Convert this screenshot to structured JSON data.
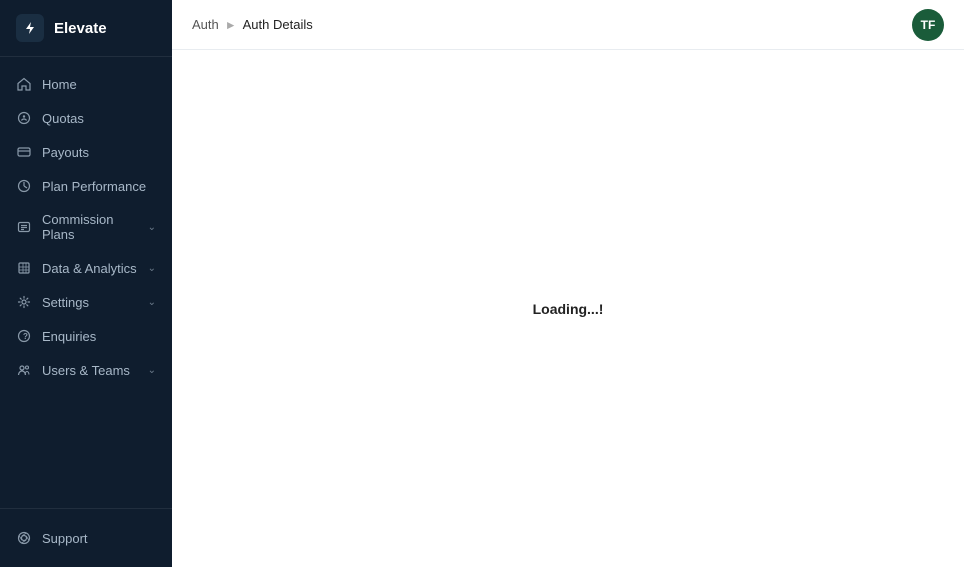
{
  "app": {
    "name": "Elevate",
    "logo_symbol": "⚡"
  },
  "breadcrumb": {
    "parent": "Auth",
    "separator": "▶",
    "current": "Auth Details"
  },
  "avatar": {
    "initials": "TF",
    "bg_color": "#1a5c3a"
  },
  "content": {
    "loading_text": "Loading...!"
  },
  "sidebar": {
    "nav_items": [
      {
        "id": "home",
        "label": "Home",
        "icon": "home"
      },
      {
        "id": "quotas",
        "label": "Quotas",
        "icon": "quotas"
      },
      {
        "id": "payouts",
        "label": "Payouts",
        "icon": "payouts"
      },
      {
        "id": "plan-performance",
        "label": "Plan Performance",
        "icon": "plan-performance"
      },
      {
        "id": "commission-plans",
        "label": "Commission Plans",
        "icon": "commission-plans",
        "has_chevron": true
      },
      {
        "id": "data-analytics",
        "label": "Data & Analytics",
        "icon": "data-analytics",
        "has_chevron": true
      },
      {
        "id": "settings",
        "label": "Settings",
        "icon": "settings",
        "has_chevron": true
      },
      {
        "id": "enquiries",
        "label": "Enquiries",
        "icon": "enquiries"
      },
      {
        "id": "users-teams",
        "label": "Users & Teams",
        "icon": "users-teams",
        "has_chevron": true
      }
    ],
    "footer_item": {
      "id": "support",
      "label": "Support",
      "icon": "support"
    }
  }
}
